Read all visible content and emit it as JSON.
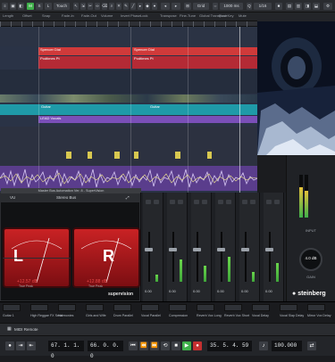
{
  "toolbar": {
    "mode": "Touch",
    "grid": "Grid",
    "quantize": "1/16",
    "zoom": "1000 ms"
  },
  "infoline": {
    "fields": [
      {
        "label": "Length",
        "value": ""
      },
      {
        "label": "Offset",
        "value": ""
      },
      {
        "label": "Snap",
        "value": ""
      },
      {
        "label": "Fade-In",
        "value": ""
      },
      {
        "label": "Fade-Out",
        "value": ""
      },
      {
        "label": "Volume",
        "value": ""
      },
      {
        "label": "Invert Phase",
        "value": ""
      },
      {
        "label": "Lock",
        "value": ""
      },
      {
        "label": "Transpose",
        "value": ""
      },
      {
        "label": "Fine-Tune",
        "value": ""
      },
      {
        "label": "Global Transpose",
        "value": ""
      },
      {
        "label": "Root Key",
        "value": ""
      },
      {
        "label": "Mute",
        "value": ""
      }
    ]
  },
  "project": {
    "clips": {
      "spencer1": "Spencer Dial",
      "spencer2": "Spencer Dial",
      "podcast1": "Podtimes Pt",
      "podcast2": "Podtimes Pt",
      "guitar1": "Guitar",
      "guitar2": "Guitar",
      "lead": "LEAD Vocals"
    }
  },
  "vu": {
    "window_title": "Master Bus Automation Ver. 8 - SuperVision",
    "preset": "VU",
    "bus": "Stereo Bus",
    "left_label": "L",
    "right_label": "R",
    "left_peak": "+12.57 dB",
    "right_peak": "+12.88 dB",
    "left_sub": "True Peak",
    "right_sub": "True Peak",
    "brand": "supervision"
  },
  "mixer": {
    "channels": [
      {
        "name": "",
        "value": "0.00",
        "level": 0.15
      },
      {
        "name": "",
        "value": "0.00",
        "level": 0.45
      },
      {
        "name": "",
        "value": "0.00",
        "level": 0.32
      },
      {
        "name": "",
        "value": "0.00",
        "level": 0.5
      },
      {
        "name": "",
        "value": "0.00",
        "level": 0.2
      },
      {
        "name": "",
        "value": "0.00",
        "level": 0.38
      }
    ]
  },
  "rpanel": {
    "input_label": "INPUT",
    "gain_value": "4.0 dB",
    "gain_label": "GAIN",
    "brand": "steinberg"
  },
  "quick_controls": [
    "Guitar 1",
    "High Reggae FX Send",
    "Harmonies",
    "Girls and Wife",
    "Drum Parallel",
    "Vocal Parallel",
    "Compression",
    "Reverb Vox Long",
    "Reverb Vox Short",
    "Vocal Delay",
    "Vocal Slap Delay",
    "Mirror Vox Delay"
  ],
  "remote": {
    "label": "MIDI Remote"
  },
  "transport": {
    "left_counter": "67. 1. 1. 0",
    "mid_counter": "66. 0. 0. 0",
    "right_counter": "35. 5. 4. 59",
    "tempo": "100.000"
  }
}
